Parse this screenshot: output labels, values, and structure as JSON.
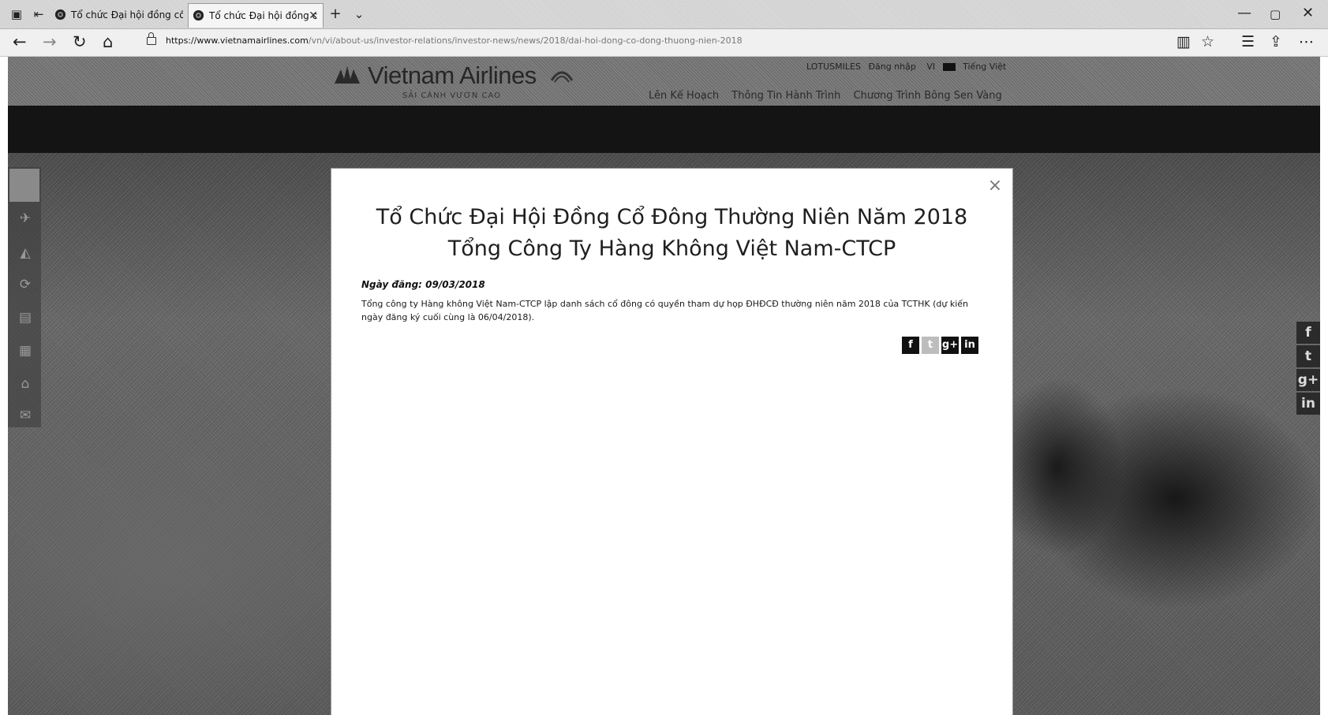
{
  "browser": {
    "tabs": [
      {
        "title": "Tổ chức Đại hội đồng cổ đô",
        "active": false
      },
      {
        "title": "Tổ chức Đại hội đồng c",
        "active": true
      }
    ],
    "new_tab_label": "+",
    "tab_menu_label": "⌄",
    "url_host": "https://www.vietnamairlines.com",
    "url_path": "/vn/vi/about-us/investor-relations/investor-news/news/2018/dai-hoi-dong-co-dong-thuong-nien-2018",
    "window_controls": [
      "—",
      "▢",
      "✕"
    ]
  },
  "site": {
    "logo_text": "Vietnam Airlines",
    "tagline": "SẢI CÁNH VƯƠN CAO",
    "top_links": [
      "LOTUSMILES",
      "Đăng nhập",
      "VI",
      "Tiếng Việt"
    ],
    "nav_items": [
      "Lên Kế Hoạch",
      "Thông Tin Hành Trình",
      "Chương Trình Bông Sen Vàng"
    ]
  },
  "modal": {
    "title": "Tổ Chức Đại Hội Đồng Cổ Đông Thường Niên Năm 2018 Tổng Công Ty Hàng Không Việt Nam-CTCP",
    "date_label": "Ngày đăng: 09/03/2018",
    "body": "Tổng công ty Hàng không Việt Nam-CTCP lập danh sách cổ đông có quyền tham dự họp ĐHĐCĐ thường niên năm 2018 của TCTHK (dự kiến ngày đăng ký cuối cùng là 06/04/2018).",
    "close_label": "×",
    "share": [
      {
        "name": "facebook-icon",
        "glyph": "f"
      },
      {
        "name": "twitter-icon",
        "glyph": "t"
      },
      {
        "name": "google-plus-icon",
        "glyph": "g+"
      },
      {
        "name": "linkedin-icon",
        "glyph": "in"
      }
    ]
  },
  "side_share": [
    "f",
    "t",
    "g+",
    "in"
  ],
  "colors": {
    "modal_bg": "#ffffff",
    "overlay": "#5a5a5a",
    "header_band": "#141414"
  }
}
